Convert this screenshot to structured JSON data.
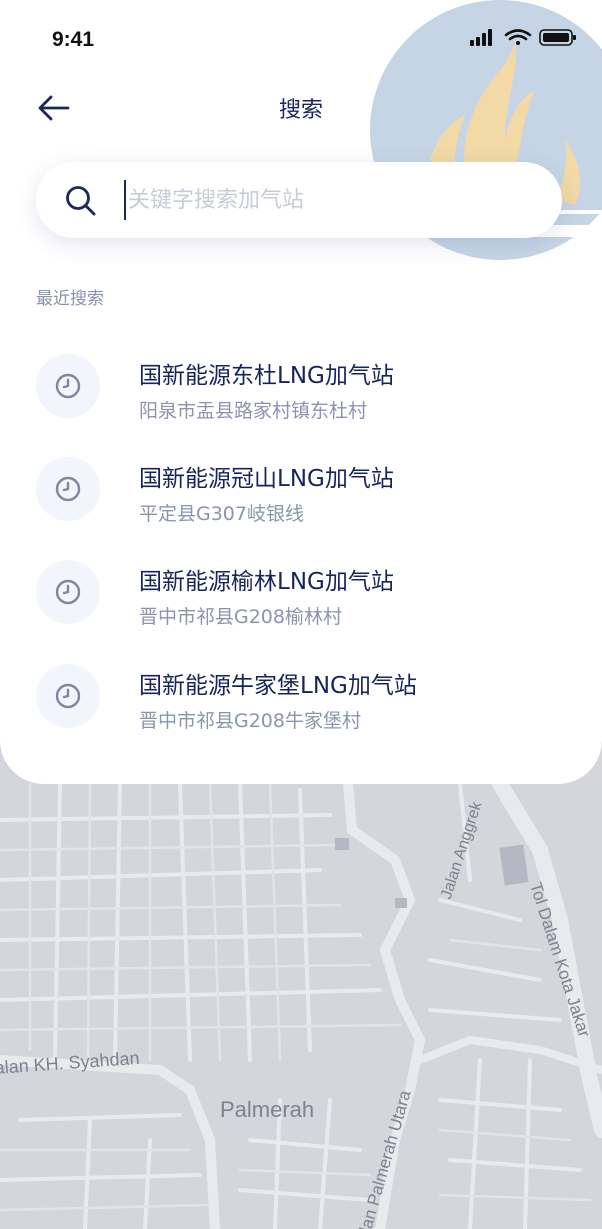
{
  "status_bar": {
    "time": "9:41",
    "icons": [
      "signal-icon",
      "wifi-icon",
      "battery-icon"
    ]
  },
  "header": {
    "title": "搜索",
    "back_icon": "arrow-left-icon"
  },
  "search": {
    "placeholder": "关键字搜索加气站",
    "value": "",
    "icon": "search-icon"
  },
  "recent": {
    "title": "最近搜索",
    "items": [
      {
        "name": "国新能源东杜LNG加气站",
        "address": "阳泉市盂县路家村镇东杜村",
        "icon": "clock-icon"
      },
      {
        "name": "国新能源冠山LNG加气站",
        "address": "平定县G307岐银线",
        "icon": "clock-icon"
      },
      {
        "name": "国新能源榆林LNG加气站",
        "address": "晋中市祁县G208榆林村",
        "icon": "clock-icon"
      },
      {
        "name": "国新能源牛家堡LNG加气站",
        "address": "晋中市祁县G208牛家堡村",
        "icon": "clock-icon"
      }
    ]
  },
  "map": {
    "labels": {
      "syahdan": "alan KH. Syahdan",
      "palmerah": "Palmerah",
      "palmerah_utara": "lan Palmerah Utara",
      "anggrek": "Jalan Anggrek",
      "tol": "Tol Dalam Kota Jakar"
    }
  },
  "colors": {
    "primary": "#1a2858",
    "muted": "#8c94ad",
    "map_bg": "#d5d6dc",
    "deco_circle": "#c6d5e5",
    "deco_flame": "#f2d9a6"
  }
}
